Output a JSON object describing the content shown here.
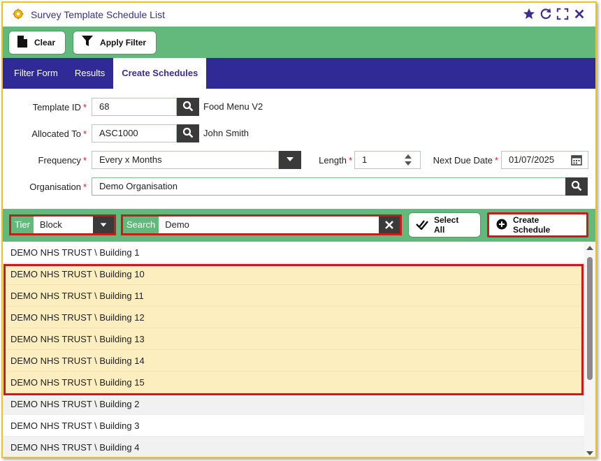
{
  "window": {
    "title": "Survey Template Schedule List"
  },
  "toolbar": {
    "clear_label": "Clear",
    "apply_filter_label": "Apply Filter"
  },
  "tabs": [
    {
      "label": "Filter Form",
      "active": false
    },
    {
      "label": "Results",
      "active": false
    },
    {
      "label": "Create Schedules",
      "active": true
    }
  ],
  "form": {
    "template_id": {
      "label": "Template ID",
      "value": "68",
      "lookup_text": "Food Menu V2"
    },
    "allocated_to": {
      "label": "Allocated To",
      "value": "ASC1000",
      "lookup_text": "John Smith"
    },
    "frequency": {
      "label": "Frequency",
      "value": "Every x Months"
    },
    "length": {
      "label": "Length",
      "value": "1"
    },
    "next_due_date": {
      "label": "Next Due Date",
      "value": "01/07/2025"
    },
    "organisation": {
      "label": "Organisation",
      "value": "Demo Organisation"
    },
    "required_marker": "*"
  },
  "filterbar": {
    "tier_label": "Tier",
    "tier_value": "Block",
    "search_label": "Search",
    "search_value": "Demo",
    "select_all_label": "Select All",
    "create_schedule_label": "Create Schedule"
  },
  "list": {
    "items": [
      {
        "label": "DEMO NHS TRUST \\ Building 1",
        "selected": false
      },
      {
        "label": "DEMO NHS TRUST \\ Building 10",
        "selected": true
      },
      {
        "label": "DEMO NHS TRUST \\ Building 11",
        "selected": true
      },
      {
        "label": "DEMO NHS TRUST \\ Building 12",
        "selected": true
      },
      {
        "label": "DEMO NHS TRUST \\ Building 13",
        "selected": true
      },
      {
        "label": "DEMO NHS TRUST \\ Building 14",
        "selected": true
      },
      {
        "label": "DEMO NHS TRUST \\ Building 15",
        "selected": true
      },
      {
        "label": "DEMO NHS TRUST \\ Building 2",
        "selected": false
      },
      {
        "label": "DEMO NHS TRUST \\ Building 3",
        "selected": false
      },
      {
        "label": "DEMO NHS TRUST \\ Building 4",
        "selected": false
      }
    ]
  },
  "colors": {
    "accent_green": "#63b97c",
    "tab_bar_blue": "#2f2a96",
    "highlight_red": "#cc1a1a",
    "selected_row": "#fdeec0",
    "window_border": "#f1c21b"
  }
}
